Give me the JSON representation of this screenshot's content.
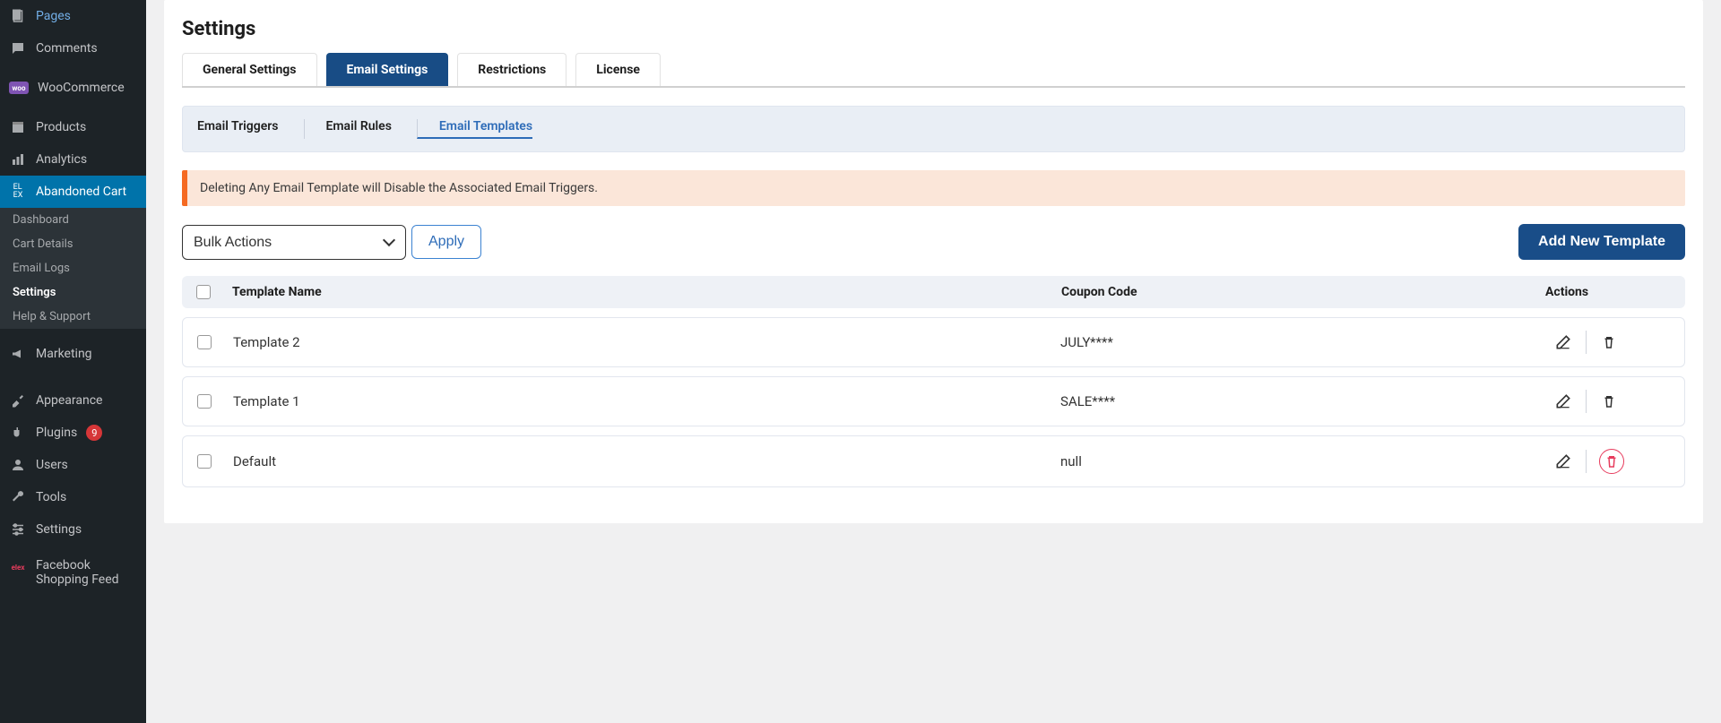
{
  "sidebar": {
    "items": [
      {
        "label": "Pages",
        "icon": "pages"
      },
      {
        "label": "Comments",
        "icon": "comments"
      },
      {
        "label": "WooCommerce",
        "icon": "woo"
      },
      {
        "label": "Products",
        "icon": "box"
      },
      {
        "label": "Analytics",
        "icon": "chart"
      },
      {
        "label": "Abandoned Cart",
        "icon": "elex"
      }
    ],
    "subitems": [
      "Dashboard",
      "Cart Details",
      "Email Logs",
      "Settings",
      "Help & Support"
    ],
    "bottom": [
      {
        "label": "Marketing",
        "icon": "megaphone"
      },
      {
        "label": "Appearance",
        "icon": "brush"
      },
      {
        "label": "Plugins",
        "icon": "plug",
        "badge": "9"
      },
      {
        "label": "Users",
        "icon": "user"
      },
      {
        "label": "Tools",
        "icon": "wrench"
      },
      {
        "label": "Settings",
        "icon": "sliders"
      },
      {
        "label": "Facebook Shopping Feed",
        "icon": "elexfb"
      }
    ]
  },
  "page": {
    "title": "Settings"
  },
  "tabs": [
    "General Settings",
    "Email Settings",
    "Restrictions",
    "License"
  ],
  "subtabs": [
    "Email Triggers",
    "Email Rules",
    "Email Templates"
  ],
  "alert": "Deleting Any Email Template will Disable the Associated Email Triggers.",
  "controls": {
    "bulk_label": "Bulk Actions",
    "apply_label": "Apply",
    "add_label": "Add New Template"
  },
  "table": {
    "headers": {
      "name": "Template Name",
      "coupon": "Coupon Code",
      "actions": "Actions"
    },
    "rows": [
      {
        "name": "Template 2",
        "coupon": "JULY****"
      },
      {
        "name": "Template 1",
        "coupon": "SALE****"
      },
      {
        "name": "Default",
        "coupon": "null",
        "locked_delete": true
      }
    ]
  }
}
